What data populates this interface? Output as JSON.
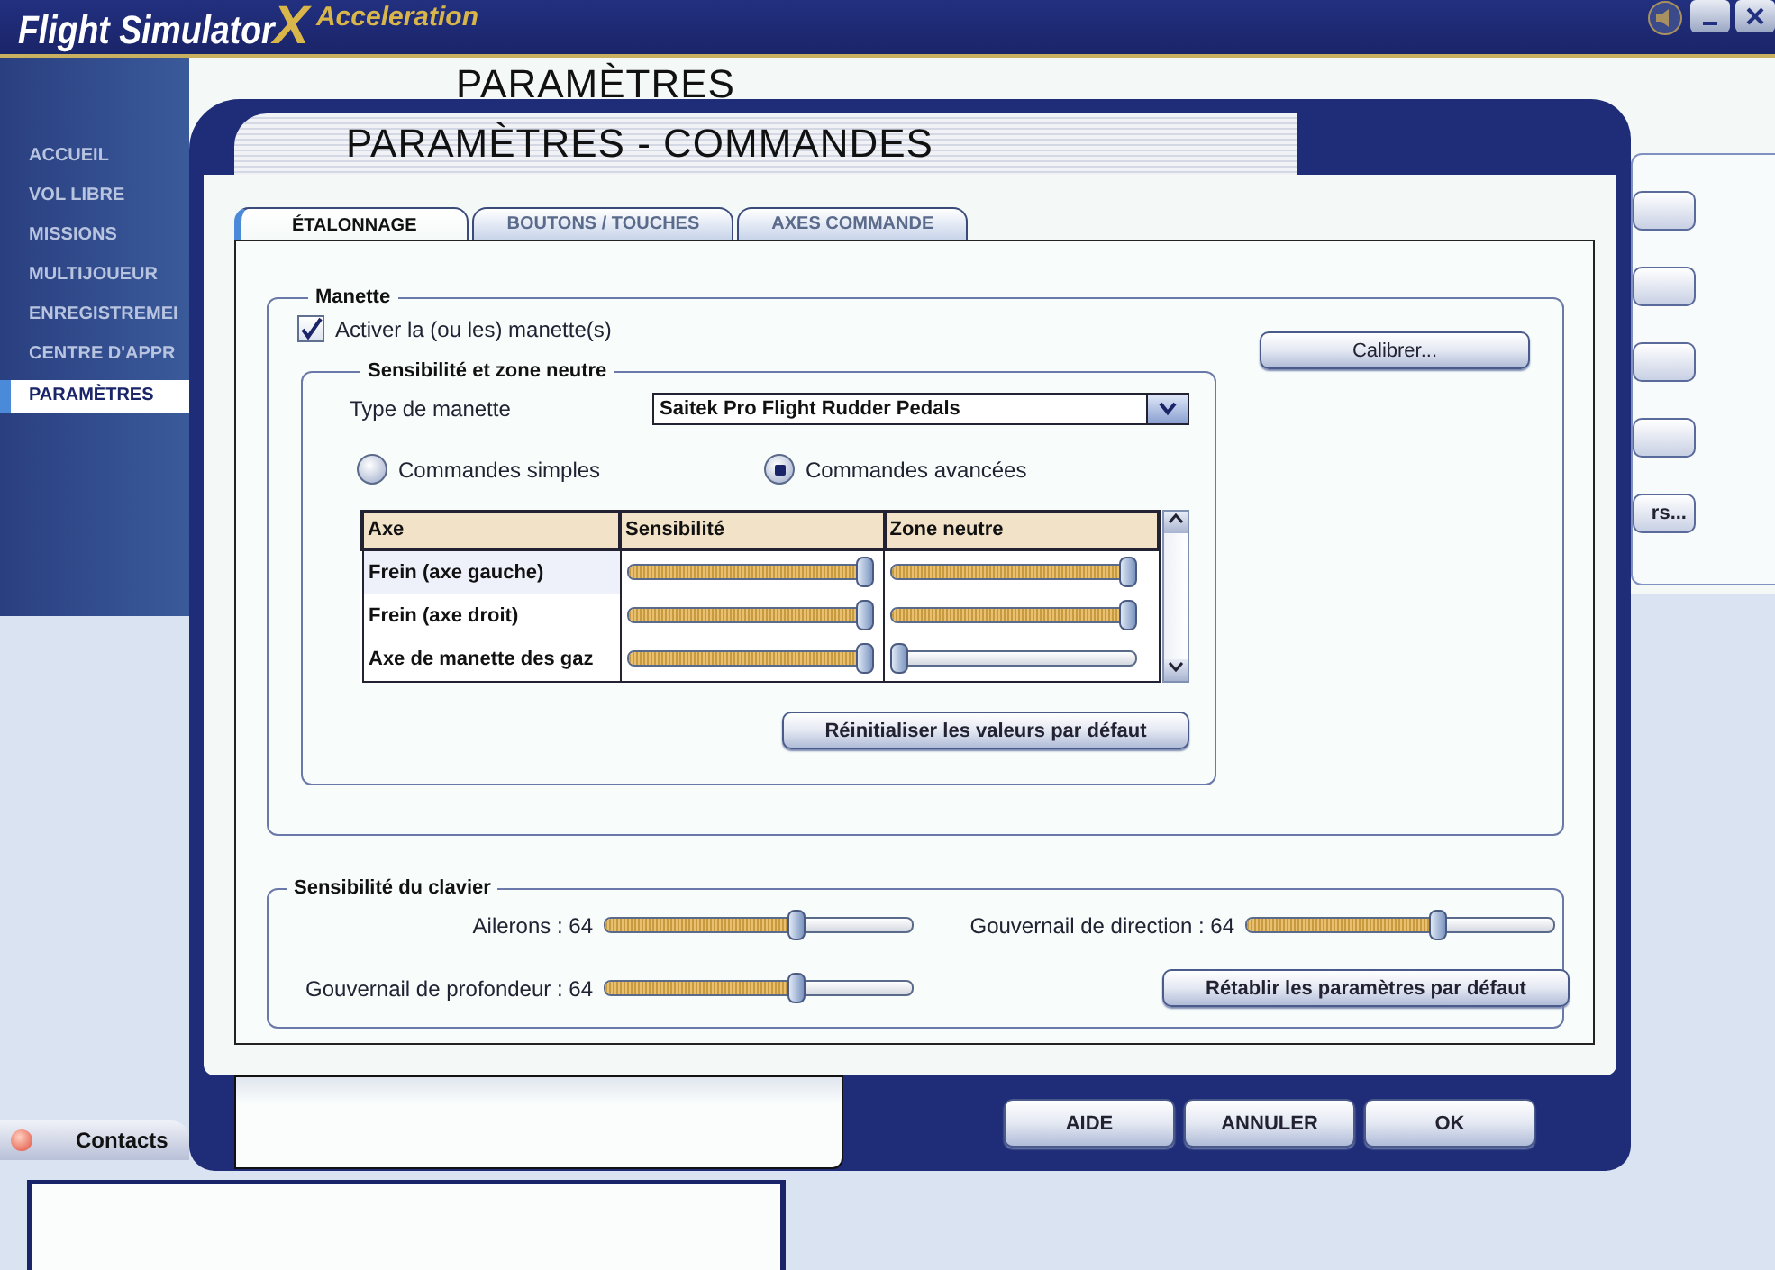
{
  "app": {
    "logo_title": "Flight Simulator",
    "logo_letter": "X",
    "logo_subtitle": "Acceleration",
    "page_title": "PARAMÈTRES"
  },
  "sidebar": {
    "items": [
      {
        "label": "ACCUEIL",
        "selected": false
      },
      {
        "label": "VOL LIBRE",
        "selected": false
      },
      {
        "label": "MISSIONS",
        "selected": false
      },
      {
        "label": "MULTIJOUEUR",
        "selected": false
      },
      {
        "label": "ENREGISTREMEI",
        "selected": false
      },
      {
        "label": "CENTRE D'APPR",
        "selected": false
      },
      {
        "label": "PARAMÈTRES",
        "selected": true
      }
    ]
  },
  "side_panel": {
    "last_button": "rs..."
  },
  "contacts_bar": {
    "label": "Contacts"
  },
  "dialog": {
    "title": "PARAMÈTRES - COMMANDES",
    "tabs": [
      {
        "label": "ÉTALONNAGE",
        "selected": true
      },
      {
        "label": "BOUTONS / TOUCHES",
        "selected": false
      },
      {
        "label": "AXES COMMANDE",
        "selected": false
      }
    ],
    "controller_group": {
      "title": "Manette",
      "enable_checkbox": {
        "label": "Activer la (ou les) manette(s)",
        "checked": true
      },
      "calibrate_button": "Calibrer...",
      "sensitivity_group": {
        "title": "Sensibilité et zone neutre",
        "type_label": "Type de manette",
        "type_value": "Saitek Pro Flight Rudder Pedals",
        "modes": [
          {
            "label": "Commandes simples",
            "selected": false
          },
          {
            "label": "Commandes avancées",
            "selected": true
          }
        ],
        "table": {
          "columns": [
            "Axe",
            "Sensibilité",
            "Zone neutre"
          ],
          "rows": [
            {
              "axis": "Frein (axe gauche)",
              "selected": true,
              "sensitivity": {
                "level": 1.0
              },
              "null_zone": {
                "level": 1.0
              }
            },
            {
              "axis": "Frein (axe droit)",
              "selected": false,
              "sensitivity": {
                "level": 1.0
              },
              "null_zone": {
                "level": 1.0
              }
            },
            {
              "axis": "Axe de manette des gaz",
              "selected": false,
              "sensitivity": {
                "level": 1.0
              },
              "null_zone": {
                "level": 0.0
              }
            }
          ]
        },
        "reset_button": "Réinitialiser les valeurs par défaut"
      }
    },
    "keyboard_group": {
      "title": "Sensibilité du clavier",
      "sliders": [
        {
          "label": "Ailerons : 64",
          "level": 0.63
        },
        {
          "label": "Gouvernail de direction : 64",
          "level": 0.63
        },
        {
          "label": "Gouvernail de profondeur : 64",
          "level": 0.63
        }
      ],
      "restore_button": "Rétablir les paramètres par défaut"
    },
    "buttons": [
      "AIDE",
      "ANNULER",
      "OK"
    ]
  }
}
